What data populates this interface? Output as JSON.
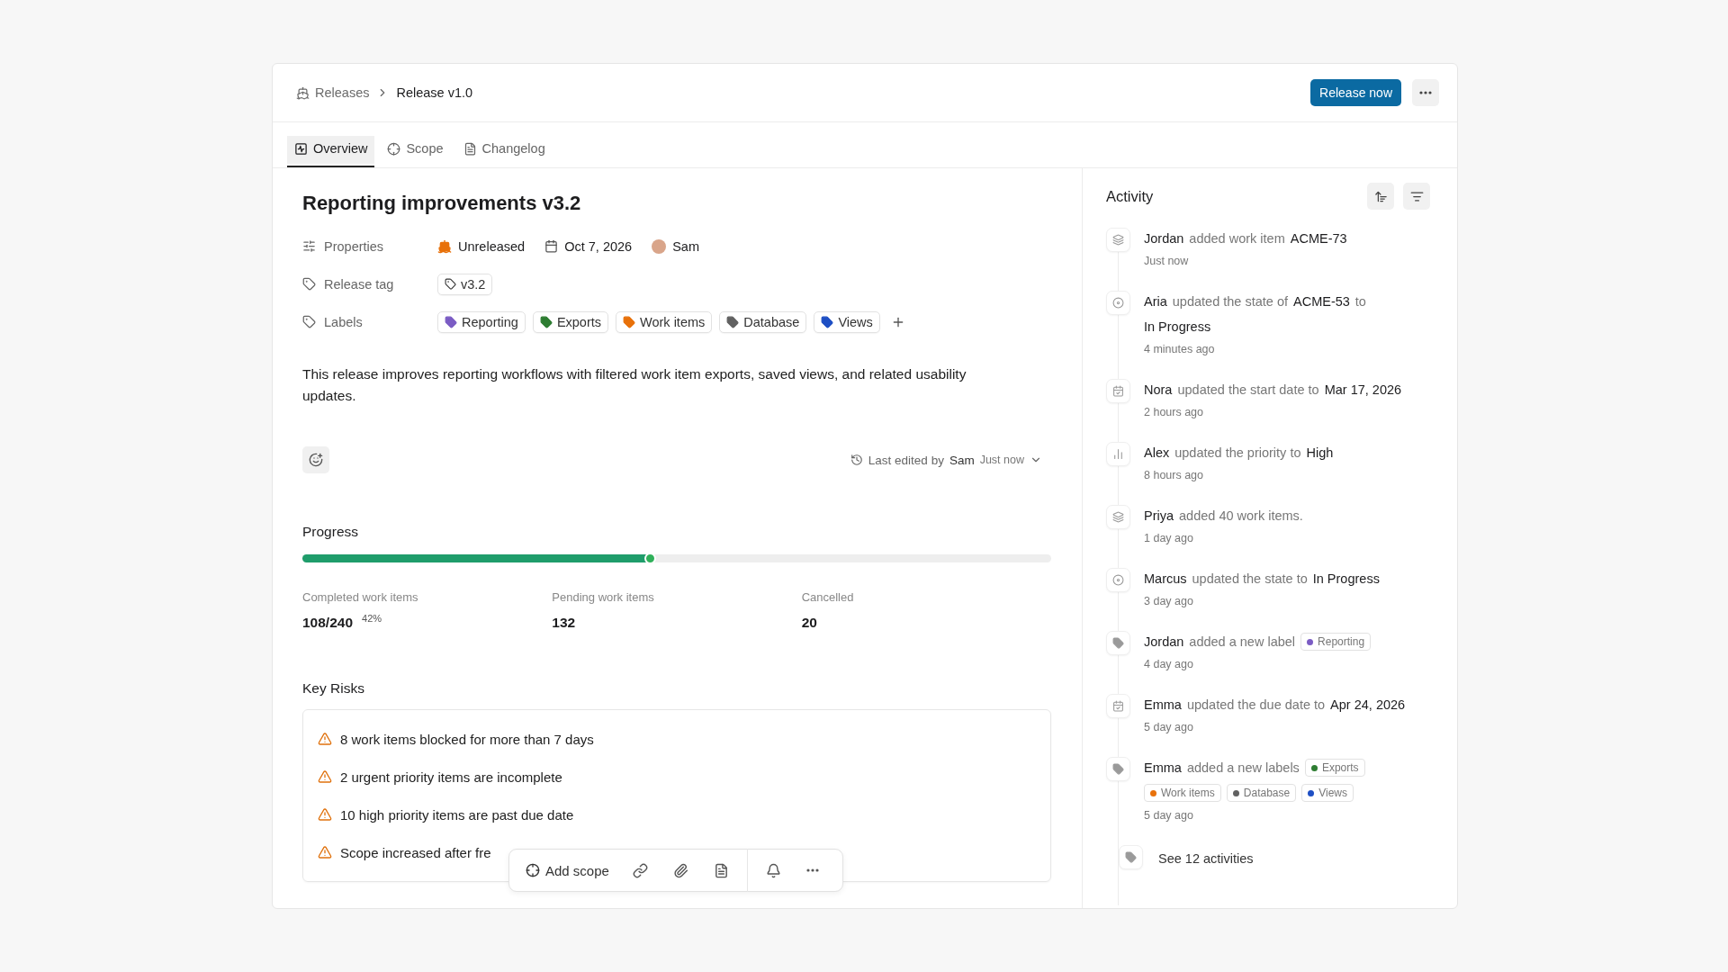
{
  "breadcrumb": {
    "parent": "Releases",
    "current": "Release v1.0"
  },
  "header_actions": {
    "primary": "Release now"
  },
  "tabs": [
    {
      "label": "Overview",
      "selected": true
    },
    {
      "label": "Scope",
      "selected": false
    },
    {
      "label": "Changelog",
      "selected": false
    }
  ],
  "release": {
    "title": "Reporting improvements v3.2",
    "properties": {
      "label": "Properties",
      "state": "Unreleased",
      "date": "Oct 7, 2026",
      "lead": "Sam"
    },
    "release_tag": {
      "label": "Release tag",
      "value": "v3.2"
    },
    "labels": {
      "label": "Labels",
      "items": [
        {
          "name": "Reporting",
          "color": "#7b5cc4"
        },
        {
          "name": "Exports",
          "color": "#2e7d32"
        },
        {
          "name": "Work items",
          "color": "#e8710a"
        },
        {
          "name": "Database",
          "color": "#616161"
        },
        {
          "name": "Views",
          "color": "#1e4fc4"
        }
      ]
    },
    "description": "This release improves reporting workflows with filtered work item exports, saved views, and related usability updates.",
    "last_edited": {
      "prefix": "Last edited by",
      "user": "Sam",
      "time": "Just now"
    }
  },
  "progress": {
    "title": "Progress",
    "level": 0.465,
    "stats": [
      {
        "label": "Completed work items",
        "value": "108/240",
        "percent": "42%"
      },
      {
        "label": "Pending work items",
        "value": "132"
      },
      {
        "label": "Cancelled",
        "value": "20"
      }
    ]
  },
  "key_risks": {
    "title": "Key Risks",
    "items": [
      "8 work items blocked for more than 7 days",
      "2 urgent priority items are incomplete",
      "10 high priority items are past due date",
      "Scope increased after fre"
    ]
  },
  "floating_toolbar": {
    "add_scope": "Add scope"
  },
  "activity": {
    "title": "Activity",
    "items": [
      {
        "kind": "workitem",
        "parts": [
          {
            "kind": "actor",
            "text": "Jordan"
          },
          {
            "kind": "text",
            "text": "added work item"
          },
          {
            "kind": "value",
            "text": "ACME-73"
          }
        ],
        "time": "Just now"
      },
      {
        "kind": "state",
        "parts": [
          {
            "kind": "actor",
            "text": "Aria"
          },
          {
            "kind": "text",
            "text": "updated the state of"
          },
          {
            "kind": "value",
            "text": "ACME-53"
          },
          {
            "kind": "text",
            "text": "to"
          },
          {
            "kind": "value",
            "text": "In Progress"
          }
        ],
        "time": "4 minutes ago"
      },
      {
        "kind": "date",
        "parts": [
          {
            "kind": "actor",
            "text": "Nora"
          },
          {
            "kind": "text",
            "text": "updated the start date to"
          },
          {
            "kind": "value",
            "text": "Mar 17, 2026"
          }
        ],
        "time": "2 hours ago"
      },
      {
        "kind": "priority",
        "parts": [
          {
            "kind": "actor",
            "text": "Alex"
          },
          {
            "kind": "text",
            "text": "updated the priority to"
          },
          {
            "kind": "value",
            "text": "High"
          }
        ],
        "time": "8 hours ago"
      },
      {
        "kind": "workitem",
        "parts": [
          {
            "kind": "actor",
            "text": "Priya"
          },
          {
            "kind": "text",
            "text": "added 40 work items."
          }
        ],
        "time": "1 day ago"
      },
      {
        "kind": "state",
        "parts": [
          {
            "kind": "actor",
            "text": "Marcus"
          },
          {
            "kind": "text",
            "text": "updated the state to"
          },
          {
            "kind": "value",
            "text": "In Progress"
          }
        ],
        "time": "3 day ago"
      },
      {
        "kind": "label",
        "parts": [
          {
            "kind": "actor",
            "text": "Jordan"
          },
          {
            "kind": "text",
            "text": "added a new label"
          },
          {
            "kind": "label",
            "text": "Reporting",
            "color": "#7b5cc4"
          }
        ],
        "time": "4 day ago"
      },
      {
        "kind": "date",
        "parts": [
          {
            "kind": "actor",
            "text": "Emma"
          },
          {
            "kind": "text",
            "text": "updated the due date to"
          },
          {
            "kind": "value",
            "text": "Apr 24, 2026"
          }
        ],
        "time": "5 day ago"
      },
      {
        "kind": "label",
        "parts": [
          {
            "kind": "actor",
            "text": "Emma"
          },
          {
            "kind": "text",
            "text": "added a new labels"
          },
          {
            "kind": "label",
            "text": "Exports",
            "color": "#2e7d32"
          },
          {
            "kind": "label",
            "text": "Work items",
            "color": "#e8710a"
          },
          {
            "kind": "label",
            "text": "Database",
            "color": "#616161"
          },
          {
            "kind": "label",
            "text": "Views",
            "color": "#1e4fc4"
          }
        ],
        "time": "5 day ago"
      }
    ],
    "see_more": "See 12 activities"
  }
}
